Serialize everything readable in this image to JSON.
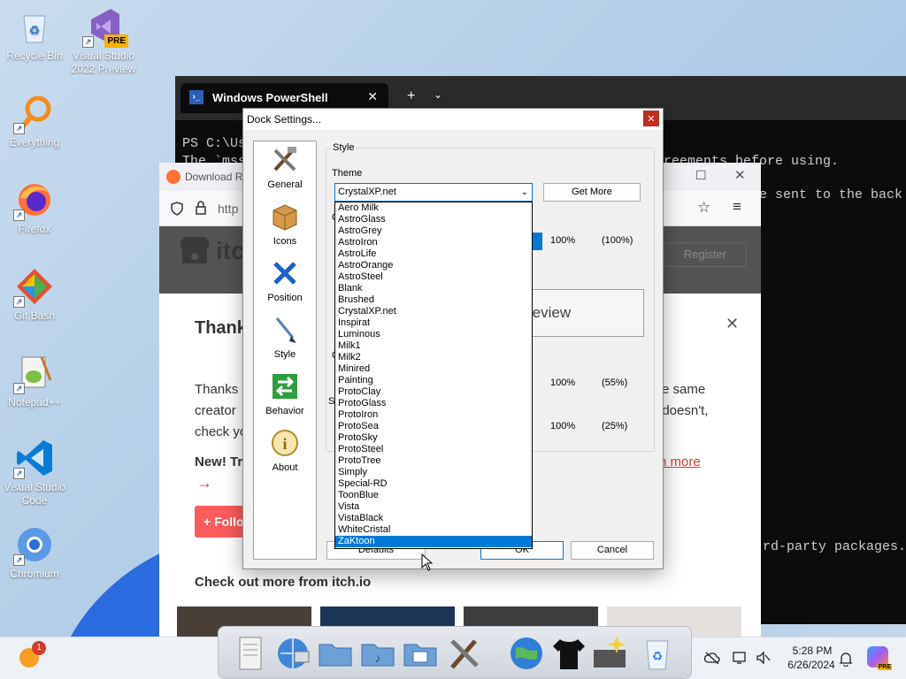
{
  "desktop_icons": [
    {
      "label": "Recycle Bin"
    },
    {
      "label": "Visual Studio 2022 Preview",
      "badge": "PRE"
    },
    {
      "label": "Everything"
    },
    {
      "label": "Firefox"
    },
    {
      "label": "Git Bash"
    },
    {
      "label": "Notepad++"
    },
    {
      "label": "Visual Studio Code"
    },
    {
      "label": "Chromium"
    }
  ],
  "powershell": {
    "tab_title": "Windows PowerShell",
    "line1": "PS C:\\Us",
    "line2": "The `mss",
    "line2_right": "reements before using.",
    "line3_right": "n",
    "line4_right": "e sent to the back",
    "line5_right": "rd-party packages."
  },
  "firefox": {
    "tab_title": "Download R",
    "url_fragment": "http",
    "itch_logo": "itch",
    "register": "Register",
    "thank_heading": "Thank",
    "review_fragment": "review",
    "para_line1_left": "Thanks",
    "para_line1_right": "e same",
    "para_line2_left": "creator",
    "para_line2_right": "t doesn't,",
    "para_line3_left": "check yo",
    "new_label": "New! Tr",
    "learn_more": "rn more",
    "arrow": "→",
    "follow": "Follo",
    "check_out_more": "Check out more from itch.io"
  },
  "dialog": {
    "title": "Dock Settings...",
    "close_glyph": "✕",
    "nav": [
      {
        "label": "General",
        "icon": "tools-icon"
      },
      {
        "label": "Icons",
        "icon": "box-icon"
      },
      {
        "label": "Position",
        "icon": "arrows-icon"
      },
      {
        "label": "Style",
        "icon": "brush-icon"
      },
      {
        "label": "Behavior",
        "icon": "swap-icon"
      },
      {
        "label": "About",
        "icon": "info-icon"
      }
    ],
    "style_group": "Style",
    "theme_label": "Theme",
    "theme_selected": "CrystalXP.net",
    "get_more": "Get More",
    "row1_pct": "100%",
    "row1_paren": "(100%)",
    "row2_pct": "100%",
    "row2_paren": "(55%)",
    "row3_pct": "100%",
    "row3_paren": "(25%)",
    "row_c1": "C",
    "row_c2": "C",
    "row_s": "S",
    "defaults": "Defaults",
    "ok": "OK",
    "cancel": "Cancel",
    "theme_options": [
      "Aero Milk",
      "AstroGlass",
      "AstroGrey",
      "AstroIron",
      "AstroLife",
      "AstroOrange",
      "AstroSteel",
      "Blank",
      "Brushed",
      "CrystalXP.net",
      "Inspirat",
      "Luminous",
      "Milk1",
      "Milk2",
      "Minired",
      "Painting",
      "ProtoClay",
      "ProtoGlass",
      "ProtoIron",
      "ProtoSea",
      "ProtoSky",
      "ProtoSteel",
      "ProtoTree",
      "Simply",
      "Special-RD",
      "ToonBlue",
      "Vista",
      "VistaBlack",
      "WhiteCristal",
      "ZaKtoon"
    ],
    "highlighted_option": "ZaKtoon"
  },
  "taskbar": {
    "weather_badge": "1",
    "time": "5:28 PM",
    "date": "6/26/2024",
    "chevron": "^",
    "copilot_badge": "PRE"
  },
  "colors": {
    "accent": "#0078d7",
    "close_red": "#c42b1c",
    "itch_red": "#fa5c5c"
  }
}
